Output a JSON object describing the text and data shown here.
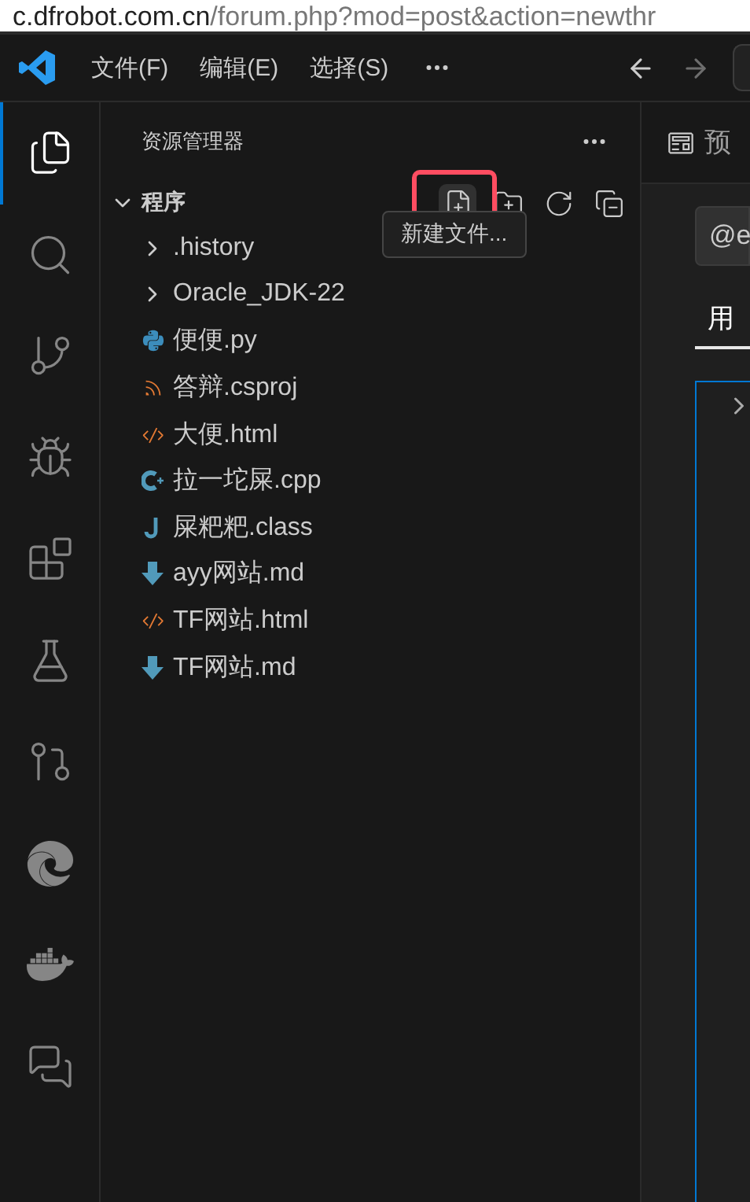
{
  "browser_bar": {
    "url_host": "c.dfrobot.com.cn",
    "url_path": "/forum.php?mod=post&action=newthr"
  },
  "title_bar": {
    "menus": [
      "文件(F)",
      "编辑(E)",
      "选择(S)"
    ]
  },
  "activity_bar": {
    "items": [
      {
        "kind": "explorer",
        "selected": true
      },
      {
        "kind": "search",
        "selected": false
      },
      {
        "kind": "source-control",
        "selected": false
      },
      {
        "kind": "run-debug",
        "selected": false
      },
      {
        "kind": "extensions",
        "selected": false
      },
      {
        "kind": "testing",
        "selected": false
      },
      {
        "kind": "git-graph",
        "selected": false
      },
      {
        "kind": "edge",
        "selected": false
      },
      {
        "kind": "docker",
        "selected": false
      },
      {
        "kind": "chat",
        "selected": false
      }
    ]
  },
  "sidebar": {
    "title": "资源管理器",
    "folder": {
      "name": "程序",
      "expanded": true,
      "tooltip": "新建文件...",
      "actions": [
        {
          "kind": "new-file",
          "highlighted": true
        },
        {
          "kind": "new-folder",
          "highlighted": false
        },
        {
          "kind": "refresh",
          "highlighted": false
        },
        {
          "kind": "collapse",
          "highlighted": false
        }
      ]
    },
    "items": [
      {
        "name": ".history",
        "kind": "folder"
      },
      {
        "name": "Oracle_JDK-22",
        "kind": "folder"
      },
      {
        "name": "便便.py",
        "kind": "python"
      },
      {
        "name": "答辩.csproj",
        "kind": "rss"
      },
      {
        "name": "大便.html",
        "kind": "html"
      },
      {
        "name": "拉一坨屎.cpp",
        "kind": "cpp"
      },
      {
        "name": "屎粑粑.class",
        "kind": "java"
      },
      {
        "name": "ayy网站.md",
        "kind": "markdown"
      },
      {
        "name": "TF网站.html",
        "kind": "html"
      },
      {
        "name": "TF网站.md",
        "kind": "markdown"
      }
    ]
  },
  "editor": {
    "tab": "预",
    "search_value": "@e",
    "section_tab": {
      "label": "用",
      "selected": true
    }
  }
}
